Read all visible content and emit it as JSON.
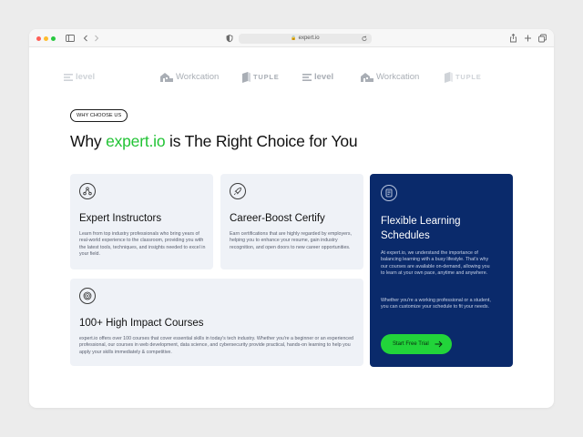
{
  "browser": {
    "url": "expert.io",
    "dots": {
      "close": "#ff5f57",
      "minimize": "#febc2e",
      "zoom": "#28c840"
    },
    "icons": [
      "sidebar-icon",
      "back-icon",
      "forward-icon",
      "shield-icon",
      "lock-icon",
      "reload-icon",
      "share-icon",
      "new-tab-icon",
      "tabs-icon"
    ]
  },
  "logos": [
    {
      "name": "level",
      "text": "level"
    },
    {
      "name": "workcation",
      "text": "Workcation"
    },
    {
      "name": "tuple",
      "text": "TUPLE"
    },
    {
      "name": "level",
      "text": "level"
    },
    {
      "name": "workcation",
      "text": "Workcation"
    },
    {
      "name": "tuple",
      "text": "TUPLE"
    }
  ],
  "section": {
    "badge": "WHY CHOOSE US",
    "headline_pre": "Why ",
    "headline_accent": "expert.io",
    "headline_post": " is The Right Choice for You",
    "accent_color": "#22c335"
  },
  "cards": {
    "instructors": {
      "icon": "network-icon",
      "title": "Expert Instructors",
      "desc": "Learn from top industry professionals who bring years of real-world experience to the classroom, providing you with the latest tools, techniques, and insights needed to excel in your field."
    },
    "certify": {
      "icon": "rocket-icon",
      "title": "Career-Boost Certify",
      "desc": "Earn certifications that are highly regarded by employers, helping you to enhance your resume, gain industry recognition, and open doors to new career opportunities."
    },
    "courses": {
      "icon": "target-icon",
      "title": "100+ High Impact Courses",
      "desc": "expert.io offers over 100 courses that cover essential skills in today's tech industry. Whether you're a beginner or an experienced professional, our courses in web development, data science, and cybersecurity provide practical, hands-on learning to help you apply your skills immediately & competitive."
    },
    "flexible": {
      "icon": "document-icon",
      "title": "Flexible Learning Schedules",
      "desc1": "At expert.io, we understand the importance of balancing learning with a busy lifestyle. That's why our courses are available on-demand, allowing you to learn at your own pace, anytime and anywhere.",
      "desc2": "Whether you're a working professional or a student, you can customize your schedule to fit your needs.",
      "button": "Start Free Trial",
      "bg_color": "#0a2a6b",
      "button_color": "#22d43a"
    }
  }
}
